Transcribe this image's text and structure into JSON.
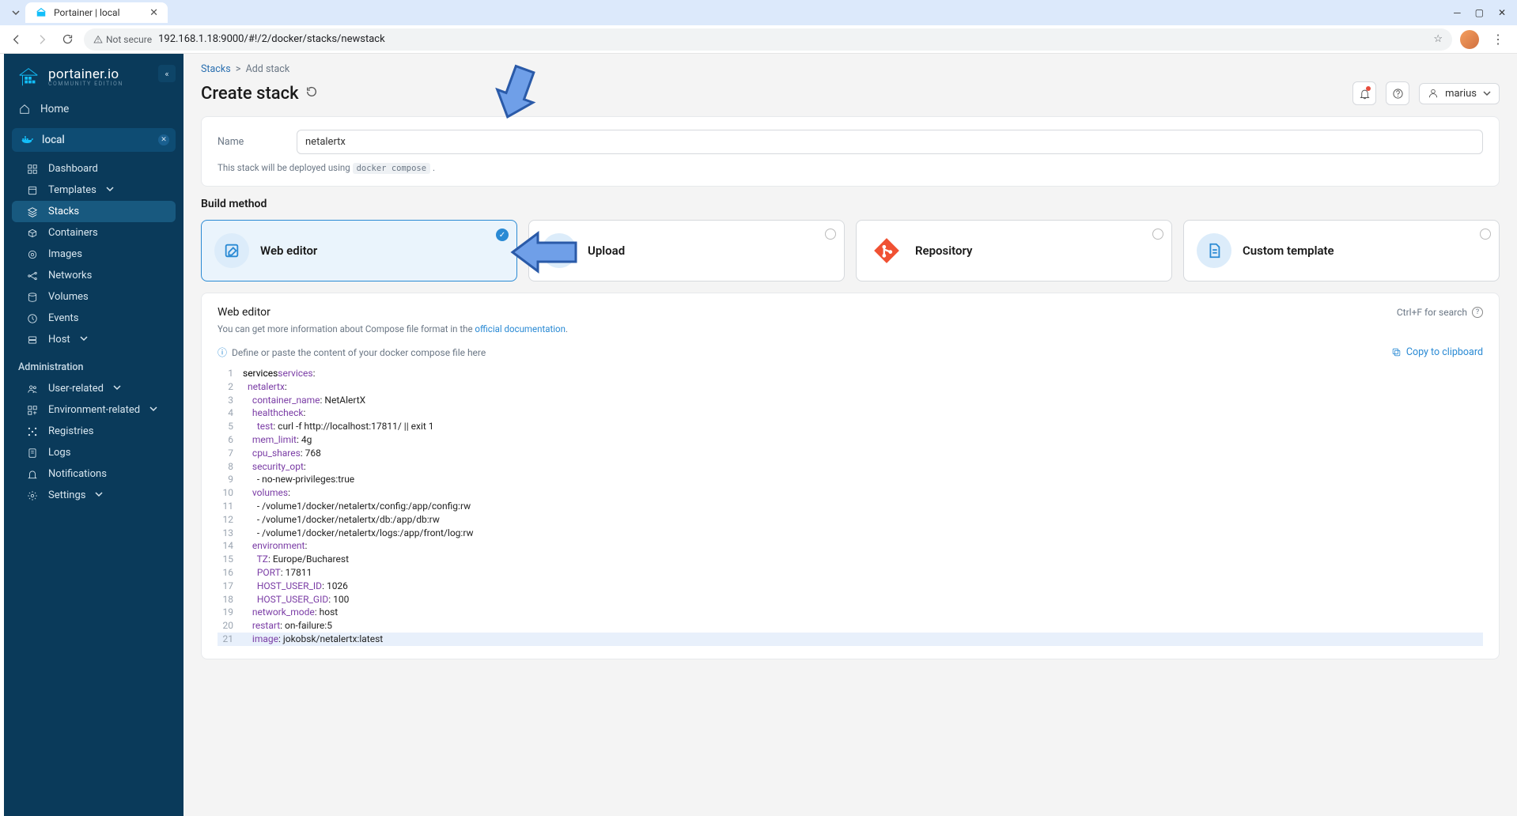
{
  "browser": {
    "tab_title": "Portainer | local",
    "security_label": "Not secure",
    "url": "192.168.1.18:9000/#!/2/docker/stacks/newstack"
  },
  "user_menu": {
    "name": "marius"
  },
  "sidebar": {
    "brand": "portainer.io",
    "brand_sub": "COMMUNITY EDITION",
    "home": "Home",
    "env_name": "local",
    "items": [
      {
        "icon": "dash",
        "label": "Dashboard"
      },
      {
        "icon": "tmpl",
        "label": "Templates",
        "chev": true
      },
      {
        "icon": "stack",
        "label": "Stacks",
        "active": true
      },
      {
        "icon": "cont",
        "label": "Containers"
      },
      {
        "icon": "img",
        "label": "Images"
      },
      {
        "icon": "net",
        "label": "Networks"
      },
      {
        "icon": "vol",
        "label": "Volumes"
      },
      {
        "icon": "evt",
        "label": "Events"
      },
      {
        "icon": "host",
        "label": "Host",
        "chev": true
      }
    ],
    "admin_label": "Administration",
    "admin_items": [
      {
        "icon": "user",
        "label": "User-related",
        "chev": true
      },
      {
        "icon": "env",
        "label": "Environment-related",
        "chev": true
      },
      {
        "icon": "reg",
        "label": "Registries"
      },
      {
        "icon": "log",
        "label": "Logs"
      },
      {
        "icon": "bell",
        "label": "Notifications"
      },
      {
        "icon": "gear",
        "label": "Settings",
        "chev": true
      }
    ]
  },
  "breadcrumb": {
    "parent": "Stacks",
    "current": "Add stack"
  },
  "page": {
    "title": "Create stack"
  },
  "form": {
    "name_label": "Name",
    "name_value": "netalertx",
    "deploy_hint_prefix": "This stack will be deployed using ",
    "deploy_hint_code": "docker compose",
    "deploy_hint_suffix": " ."
  },
  "build": {
    "title": "Build method",
    "cards": [
      {
        "label": "Web editor",
        "selected": true,
        "icon": "edit"
      },
      {
        "label": "Upload",
        "selected": false,
        "icon": "upload"
      },
      {
        "label": "Repository",
        "selected": false,
        "icon": "git"
      },
      {
        "label": "Custom template",
        "selected": false,
        "icon": "file"
      }
    ]
  },
  "editor": {
    "title": "Web editor",
    "search_hint": "Ctrl+F for search",
    "sub_prefix": "You can get more information about Compose file format in the ",
    "sub_link": "official documentation",
    "sub_suffix": ".",
    "define_hint": "Define or paste the content of your docker compose file here",
    "copy_label": "Copy to clipboard",
    "info_icon": "ⓘ",
    "code": [
      [
        "services",
        ":"
      ],
      [
        " ",
        "netalertx",
        ":"
      ],
      [
        "  ",
        "container_name",
        ":",
        " NetAlertX"
      ],
      [
        "  ",
        "healthcheck",
        ":"
      ],
      [
        "   ",
        "test",
        ":",
        " curl -f http://localhost:17811/ || exit 1"
      ],
      [
        "  ",
        "mem_limit",
        ":",
        " 4g"
      ],
      [
        "  ",
        "cpu_shares",
        ":",
        " 768"
      ],
      [
        "  ",
        "security_opt",
        ":"
      ],
      [
        "   ",
        "- no-new-privileges:true",
        ""
      ],
      [
        "  ",
        "volumes",
        ":"
      ],
      [
        "   ",
        "- /volume1/docker/netalertx/config:/app/config:rw",
        ""
      ],
      [
        "   ",
        "- /volume1/docker/netalertx/db:/app/db:rw",
        ""
      ],
      [
        "   ",
        "- /volume1/docker/netalertx/logs:/app/front/log:rw",
        ""
      ],
      [
        "  ",
        "environment",
        ":"
      ],
      [
        "   ",
        "TZ",
        ":",
        " Europe/Bucharest"
      ],
      [
        "   ",
        "PORT",
        ":",
        " 17811"
      ],
      [
        "   ",
        "HOST_USER_ID",
        ":",
        " 1026"
      ],
      [
        "   ",
        "HOST_USER_GID",
        ":",
        " 100"
      ],
      [
        "  ",
        "network_mode",
        ":",
        " host"
      ],
      [
        "  ",
        "restart",
        ":",
        " on-failure:5"
      ],
      [
        "  ",
        "image",
        ":",
        " jokobsk/netalertx:latest"
      ]
    ]
  }
}
